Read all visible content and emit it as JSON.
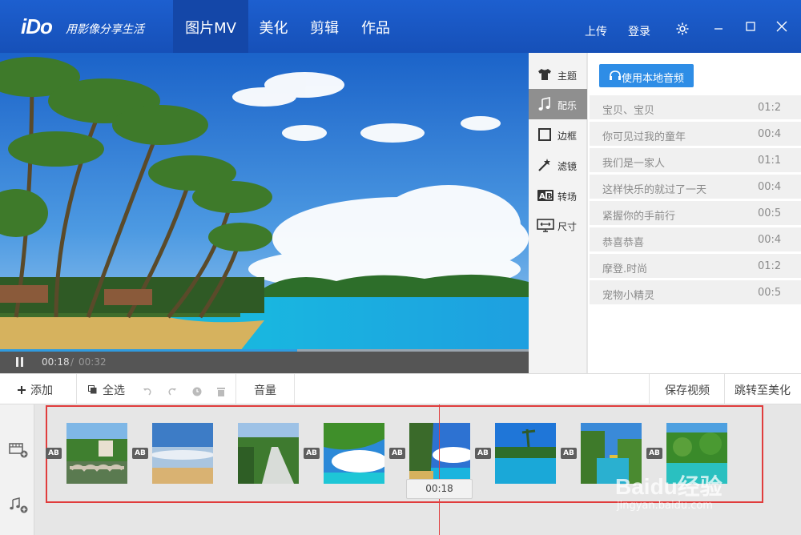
{
  "app": {
    "logo": "iDo",
    "slogan": "用影像分享生活"
  },
  "nav": {
    "tabs": [
      {
        "label": "图片MV",
        "active": true
      },
      {
        "label": "美化",
        "active": false
      },
      {
        "label": "剪辑",
        "active": false
      },
      {
        "label": "作品",
        "active": false
      }
    ]
  },
  "titlebar": {
    "upload": "上传",
    "login": "登录"
  },
  "player": {
    "current_time": "00:18",
    "separator": "/",
    "total_time": "00:32",
    "progress": 0.5625
  },
  "sidebar": {
    "items": [
      {
        "label": "主题",
        "icon": "shirt-icon",
        "active": false
      },
      {
        "label": "配乐",
        "icon": "music-note-icon",
        "active": true
      },
      {
        "label": "边框",
        "icon": "frame-icon",
        "active": false
      },
      {
        "label": "滤镜",
        "icon": "magic-wand-icon",
        "active": false
      },
      {
        "label": "转场",
        "icon": "transition-ab-icon",
        "active": false
      },
      {
        "label": "尺寸",
        "icon": "screen-size-icon",
        "active": false
      }
    ]
  },
  "music": {
    "local_button": "使用本地音频",
    "songs": [
      {
        "name": "宝贝、宝贝",
        "duration": "01:2"
      },
      {
        "name": "你可见过我的童年",
        "duration": "00:4"
      },
      {
        "name": "我们是一家人",
        "duration": "01:1"
      },
      {
        "name": "这样快乐的就过了一天",
        "duration": "00:4"
      },
      {
        "name": "紧握你的手前行",
        "duration": "00:5"
      },
      {
        "name": "恭喜恭喜",
        "duration": "00:4"
      },
      {
        "name": "摩登.时尚",
        "duration": "01:2"
      },
      {
        "name": "宠物小精灵",
        "duration": "00:5"
      }
    ]
  },
  "toolbar": {
    "add": "添加",
    "select_all": "全选",
    "volume": "音量",
    "save_video": "保存视频",
    "jump_beautify": "跳转至美化"
  },
  "timeline": {
    "transition_label": "AB",
    "playhead_time": "00:18"
  },
  "watermark": {
    "brand": "Baidu经验",
    "url": "jingyan.baidu.com"
  },
  "colors": {
    "titlebar": "#1d5fcf",
    "accent": "#2e8de6",
    "selection_frame": "#e03c3c"
  }
}
